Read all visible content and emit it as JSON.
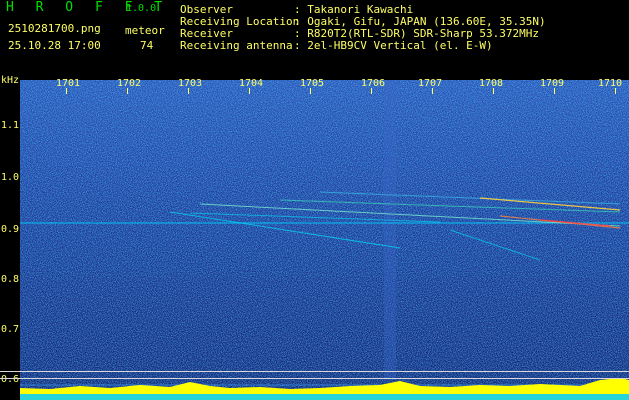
{
  "header": {
    "app_title": "H R O F F T",
    "version": "1.0.0",
    "file_name": "2510281700.png",
    "datetime": "25.10.28 17:00",
    "meteor_label": "meteor",
    "meteor_count": "74",
    "meta": [
      {
        "key": "Observer",
        "value": ": Takanori Kawachi"
      },
      {
        "key": "Receiving Location",
        "value": ": Ogaki, Gifu, JAPAN (136.60E, 35.35N)"
      },
      {
        "key": "Receiver",
        "value": ": R820T2(RTL-SDR) SDR-Sharp 53.372MHz"
      },
      {
        "key": "Receiving antenna",
        "value": ": 2el-HB9CV Vertical (el. E-W)"
      }
    ]
  },
  "axes": {
    "y_unit": "kHz",
    "y_ticks": [
      "1.1",
      "1.0",
      "0.9",
      "0.8",
      "0.7",
      "0.6"
    ],
    "x_ticks": [
      "1701",
      "1702",
      "1703",
      "1704",
      "1705",
      "1706",
      "1707",
      "1708",
      "1709",
      "1710"
    ]
  },
  "colors": {
    "background": "#000000",
    "header_text": "#ffff66",
    "title_text": "#00e000",
    "spectrogram_base": "#12207a",
    "signal_band": "#ffff00",
    "baseline": "#00ccff"
  }
}
